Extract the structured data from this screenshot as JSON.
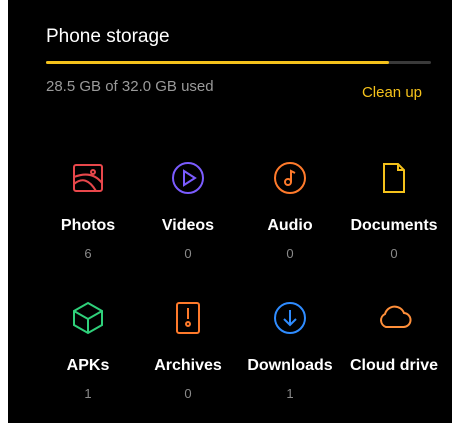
{
  "storage": {
    "title": "Phone storage",
    "used_text": "28.5 GB of 32.0 GB used",
    "used_fraction": 0.89,
    "cleanup_label": "Clean up",
    "accent": "#f5c21b"
  },
  "categories": [
    {
      "label": "Photos",
      "count": "6",
      "icon": "image-icon",
      "color": "#e8474b"
    },
    {
      "label": "Videos",
      "count": "0",
      "icon": "play-icon",
      "color": "#7b5cff"
    },
    {
      "label": "Audio",
      "count": "0",
      "icon": "music-note-icon",
      "color": "#ff7a2b"
    },
    {
      "label": "Documents",
      "count": "0",
      "icon": "document-icon",
      "color": "#f5c21b"
    },
    {
      "label": "APKs",
      "count": "1",
      "icon": "package-cube-icon",
      "color": "#2fd07a"
    },
    {
      "label": "Archives",
      "count": "0",
      "icon": "archive-icon",
      "color": "#ff7a2b"
    },
    {
      "label": "Downloads",
      "count": "1",
      "icon": "download-icon",
      "color": "#2f8cff"
    },
    {
      "label": "Cloud drive",
      "count": "",
      "icon": "cloud-icon",
      "color": "#ff8f3a"
    }
  ]
}
